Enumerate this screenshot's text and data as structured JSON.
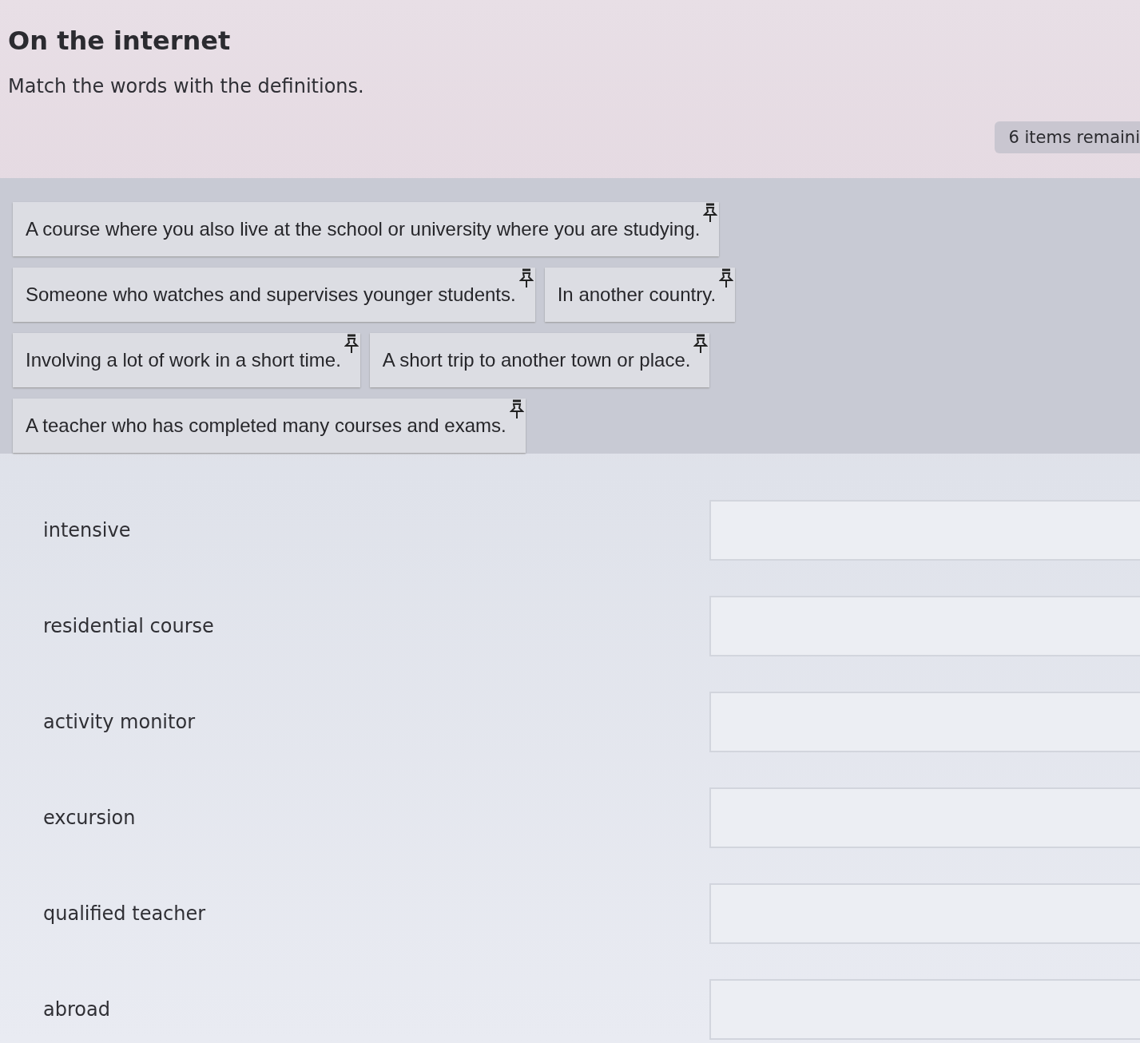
{
  "title": "On the internet",
  "instruction": "Match the words with the definitions.",
  "remaining_badge": "6 items remaini",
  "definitions": [
    {
      "text": "A course where you also live at the school or university where you are studying."
    },
    {
      "text": "Someone who watches and supervises younger students."
    },
    {
      "text": "In another country."
    },
    {
      "text": "Involving a lot of work in a short time."
    },
    {
      "text": "A short trip to another town or place."
    },
    {
      "text": "A teacher who has completed many courses and exams."
    }
  ],
  "words": [
    {
      "text": "intensive"
    },
    {
      "text": "residential course"
    },
    {
      "text": "activity monitor"
    },
    {
      "text": "excursion"
    },
    {
      "text": "qualified teacher"
    },
    {
      "text": "abroad"
    }
  ]
}
